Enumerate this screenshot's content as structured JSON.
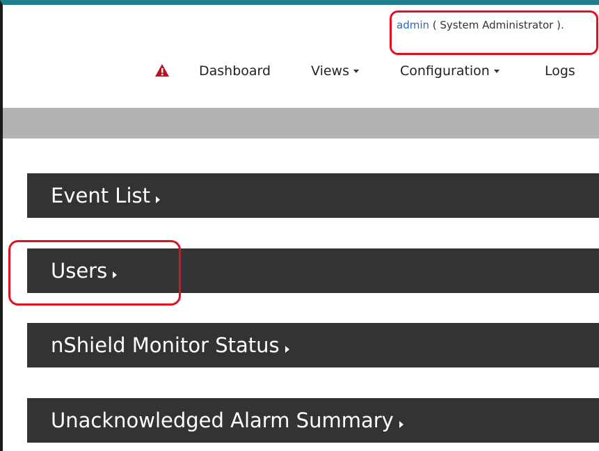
{
  "header": {
    "user_name": "admin",
    "user_role": " ( System Administrator )."
  },
  "nav": {
    "alert_icon": "warning-icon",
    "items": [
      {
        "label": "Dashboard"
      },
      {
        "label": "Views"
      },
      {
        "label": "Configuration"
      },
      {
        "label": "Logs"
      }
    ]
  },
  "panels": [
    {
      "title": "Event List"
    },
    {
      "title": "Users"
    },
    {
      "title": "nShield Monitor Status"
    },
    {
      "title": "Unacknowledged Alarm Summary"
    }
  ],
  "colors": {
    "top_accent": "#1f7f8d",
    "panel_bg": "#333333",
    "highlight": "#e0101e",
    "alert": "#c0111f"
  }
}
